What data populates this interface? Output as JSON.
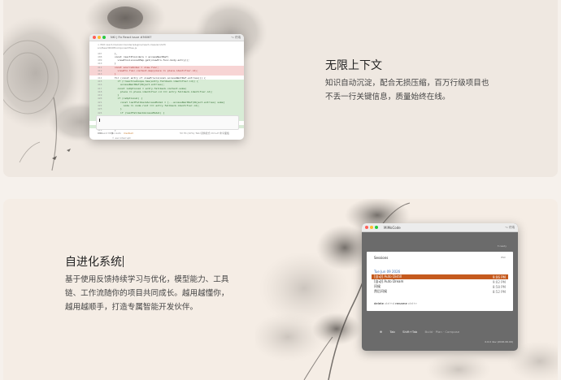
{
  "section1": {
    "title": "无限上下文",
    "description": "知识自动沉淀，配合无损压缩，百万行级项目也不丢一行关键信息，质量始终在线。",
    "window": {
      "title": "NKI | Fix React issue #36067",
      "titlebar_right": "⌥ 终端",
      "preamble": [
        "> Edit react-main/src/render/plugins/react-class/src/GH/",
        "  src/ReactDOMComponentTree.js"
      ],
      "code_lines": [
        {
          "n": "407",
          "t": "      },",
          "k": "ctx"
        },
        {
          "n": "408",
          "t": "      const reactProviders = accessNextRef(",
          "k": "ctx"
        },
        {
          "n": "409",
          "t": "        viewProvisionalMap.get(viewPro.func.body.entry));",
          "k": "ctx"
        },
        {
          "n": "410",
          "t": "      }",
          "k": "ctx"
        },
        {
          "n": "411",
          "t": "      const sourceIndex = view.func;",
          "k": "del"
        },
        {
          "n": "412",
          "t": "        viewPro.func.content.map(place => place.identifier.id);",
          "k": "del"
        },
        {
          "n": "413",
          "t": "      }",
          "k": "del"
        },
        {
          "n": "414",
          "t": "      for (const entry of viewProvisional.accessNextRef.entries()) {",
          "k": "ctx"
        },
        {
          "n": "415",
          "t": "        if (!reactiveScope.has(entry.fallback.identifier.id)) {",
          "k": "add"
        },
        {
          "n": "416",
          "t": "          accessNextRef(Object.entries);",
          "k": "add"
        },
        {
          "n": "417",
          "t": "        const isOptional = entry.fallback.content.some(",
          "k": "add"
        },
        {
          "n": "418",
          "t": "          place => place.identifier.id === entry.fallback.identifier.id);",
          "k": "add"
        },
        {
          "n": "419",
          "t": "        }",
          "k": "add"
        },
        {
          "n": "420",
          "t": "        if (isOptional) {",
          "k": "add"
        },
        {
          "n": "421",
          "t": "          const lastFallbackAccessModel = [...accessNextRef(Object.entries) some]",
          "k": "add"
        },
        {
          "n": "422",
          "t": "            node => node.root === entry.fallback.identifier.id);",
          "k": "add"
        },
        {
          "n": "423",
          "t": "          }",
          "k": "add"
        },
        {
          "n": "424",
          "t": "          if (lastFallbackAccessModel) {",
          "k": "add"
        },
        {
          "n": "425",
          "t": "            continue;",
          "k": "add"
        },
        {
          "n": "426",
          "t": "          }",
          "k": "add"
        },
        {
          "n": "427",
          "t": "        }",
          "k": "ctx"
        },
        {
          "n": "428",
          "t": "        accessNextRef(Object.add(entry));",
          "k": "add"
        },
        {
          "n": "429",
          "t": "      }",
          "k": "ctx"
        },
        {
          "n": "430",
          "t": "    }",
          "k": "ctx"
        }
      ],
      "mode_row": {
        "label": "Inbound",
        "model": "MiMo Auto",
        "level": "medium"
      },
      "status": "5ll 7K (10%)  Tab 切换模式  Ctrl+P 命令面板",
      "footer": "⇧ esc interrupt"
    }
  },
  "section2": {
    "title": "自进化系统",
    "description": "基于使用反馈持续学习与优化，模型能力、工具链、工作流随你的项目共同成长。越用越懂你，越用越顺手，打造专属智能开发伙伴。",
    "window": {
      "title": "MiMoCode",
      "titlebar_right": "⌥ 终端",
      "top_right": "3 ready",
      "panel": {
        "header": "Sessions",
        "esc": "esc",
        "date": "Tue Jun 09 2026",
        "sessions": [
          {
            "name": "[自动] Auto Distill",
            "time": "9:06 PM",
            "selected": true
          },
          {
            "name": "[自动] Auto Dream",
            "time": "9:02 PM",
            "selected": false
          },
          {
            "name": "问候",
            "time": "8:58 PM",
            "selected": false
          },
          {
            "name": "然后问候",
            "time": "8:52 PM",
            "selected": false
          }
        ],
        "hint_delete": "delete",
        "hint_delete_key": "ctrl+d",
        "hint_rename": "rename",
        "hint_rename_key": "ctrl+r"
      },
      "keys": [
        "⊕",
        "Tab",
        "Shift+Tab"
      ],
      "keys_dim": "Build · Plan · Compose",
      "version": "0.6.0 dev (2026.06.09)"
    }
  },
  "colors": {
    "accent": "#c55a1e",
    "date_blue": "#3a6fb5",
    "del_bg": "#f7d4d4",
    "add_bg": "#d8ecd6"
  }
}
